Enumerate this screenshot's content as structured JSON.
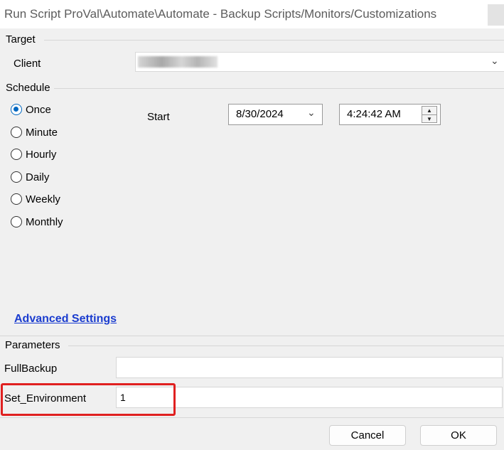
{
  "window": {
    "title": "Run Script ProVal\\Automate\\Automate - Backup Scripts/Monitors/Customizations"
  },
  "target": {
    "section_label": "Target",
    "client_label": "Client",
    "client_value": ""
  },
  "schedule": {
    "section_label": "Schedule",
    "options": [
      {
        "label": "Once",
        "checked": true
      },
      {
        "label": "Minute",
        "checked": false
      },
      {
        "label": "Hourly",
        "checked": false
      },
      {
        "label": "Daily",
        "checked": false
      },
      {
        "label": "Weekly",
        "checked": false
      },
      {
        "label": "Monthly",
        "checked": false
      }
    ],
    "start_label": "Start",
    "start_date": "8/30/2024",
    "start_time": "4:24:42 AM"
  },
  "advanced_settings": "Advanced Settings",
  "parameters": {
    "section_label": "Parameters",
    "items": [
      {
        "label": "FullBackup",
        "value": ""
      },
      {
        "label": "Set_Environment",
        "value": "1"
      }
    ]
  },
  "buttons": {
    "cancel": "Cancel",
    "ok": "OK"
  },
  "colors": {
    "accent": "#0067c0",
    "link": "#1a3ccf",
    "highlight": "#e02020"
  }
}
